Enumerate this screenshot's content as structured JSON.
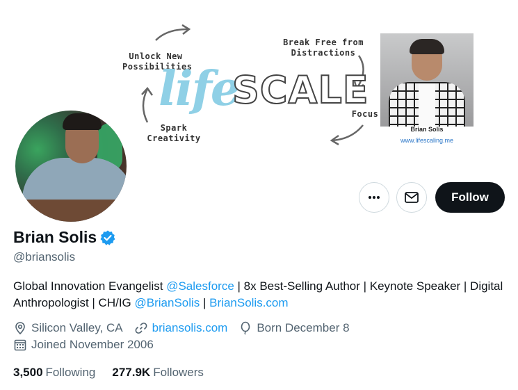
{
  "banner": {
    "unlock_text": "Unlock New Possibilities",
    "break_text": "Break Free from Distractions",
    "spark_text": "Spark Creativity",
    "focus_text": "Focus",
    "life_word": "life",
    "scale_word": "SCALE",
    "photo_name": "Brian Solis",
    "photo_url": "www.lifescaling.me"
  },
  "profile": {
    "name": "Brian Solis",
    "handle": "@briansolis",
    "bio": {
      "part1": "Global Innovation Evangelist ",
      "mention1": "@Salesforce",
      "part2": " | 8x Best-Selling Author | Keynote Speaker | Digital Anthropologist | CH/IG ",
      "mention2": "@BrianSolis",
      "part3": " | ",
      "link1": "BrianSolis.com"
    },
    "location": "Silicon Valley, CA",
    "website": "briansolis.com",
    "born": "Born December 8",
    "joined": "Joined November 2006"
  },
  "stats": {
    "following_count": "3,500",
    "following_label": "Following",
    "followers_count": "277.9K",
    "followers_label": "Followers"
  },
  "actions": {
    "follow_label": "Follow",
    "more_icon": "more-icon",
    "message_icon": "mail-icon"
  },
  "colors": {
    "accent": "#1d9bf0",
    "follow_bg": "#0f1419",
    "secondary_text": "#536471"
  }
}
